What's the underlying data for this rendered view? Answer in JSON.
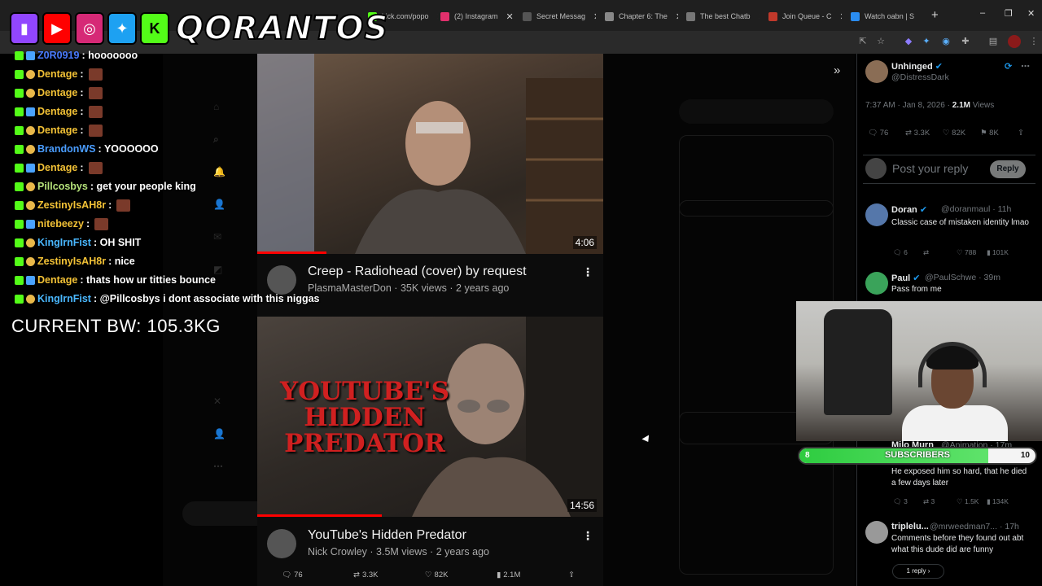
{
  "browser": {
    "tabs": [
      {
        "label": "kick.com/popo",
        "color": "#53fc18"
      },
      {
        "label": "(2) Instagram",
        "color": "#e1306c"
      },
      {
        "label": "Secret Messag",
        "color": "#3a3a3a"
      },
      {
        "label": "Chapter 6: The",
        "color": "#888888"
      },
      {
        "label": "The best Chatb",
        "color": "#777777"
      },
      {
        "label": "Join Queue - C",
        "color": "#c0392b"
      },
      {
        "label": "Watch oabn | S",
        "color": "#2a8cf0"
      }
    ],
    "newtab": "+",
    "window_controls": [
      "–",
      "❐",
      "✕"
    ]
  },
  "overlay": {
    "brand": "QORANTOS",
    "socials": [
      {
        "icon": "twitch-icon",
        "color": "#9146ff",
        "glyph": "▮"
      },
      {
        "icon": "youtube-icon",
        "color": "#ff0000",
        "glyph": "▶"
      },
      {
        "icon": "instagram-icon",
        "color": "#d62976",
        "glyph": "◎"
      },
      {
        "icon": "twitter-icon",
        "color": "#1da1f2",
        "glyph": "🐦"
      },
      {
        "icon": "kick-icon",
        "color": "#53fc18",
        "glyph": "K"
      }
    ],
    "bw_text": "CURRENT BW: 105.3KG"
  },
  "chat": [
    {
      "user": "Z0R0919",
      "color": "#4a7cff",
      "msg": ": hooooooo",
      "emote": false
    },
    {
      "user": "Dentage",
      "color": "#f3c236",
      "msg": ":",
      "emote": true
    },
    {
      "user": "Dentage",
      "color": "#f3c236",
      "msg": ":",
      "emote": true
    },
    {
      "user": "Dentage",
      "color": "#f3c236",
      "msg": ":",
      "emote": true
    },
    {
      "user": "Dentage",
      "color": "#f3c236",
      "msg": ":",
      "emote": true
    },
    {
      "user": "BrandonWS",
      "color": "#4a9dff",
      "msg": ": YOOOOOO",
      "emote": false
    },
    {
      "user": "Dentage",
      "color": "#f3c236",
      "msg": ":",
      "emote": true
    },
    {
      "user": "Pillcosbys",
      "color": "#b5e27a",
      "msg": ": get your people king",
      "emote": false
    },
    {
      "user": "ZestinyIsAH8r",
      "color": "#f3c236",
      "msg": ":",
      "emote": true
    },
    {
      "user": "nitebeezy",
      "color": "#f3c236",
      "msg": ":",
      "emote": true
    },
    {
      "user": "KingIrnFist",
      "color": "#4ab8ff",
      "msg": ": OH SHIT",
      "emote": false
    },
    {
      "user": "ZestinyIsAH8r",
      "color": "#f3c236",
      "msg": ": nice",
      "emote": false
    },
    {
      "user": "Dentage",
      "color": "#f3c236",
      "msg": ": thats how ur titties bounce",
      "emote": false
    },
    {
      "user": "KingIrnFist",
      "color": "#4ab8ff",
      "msg": ": @Pillcosbys i dont associate with this niggas",
      "emote": false
    }
  ],
  "videos": [
    {
      "title": "Creep -  Radiohead (cover) by request",
      "channel": "PlasmaMasterDon",
      "views": "35K views",
      "age": "2 years ago",
      "duration": "4:06",
      "progress": 0.2,
      "thumb_text": ""
    },
    {
      "title": "YouTube's Hidden Predator",
      "channel": "Nick Crowley",
      "views": "3.5M views",
      "age": "2 years ago",
      "duration": "14:56",
      "progress": 0.36,
      "thumb_text": "YOUTUBE'S HIDDEN PREDATOR"
    }
  ],
  "video_actions": {
    "replies": "76",
    "reposts": "3.3K",
    "likes": "82K",
    "views": "2.1M"
  },
  "tweet": {
    "name": "Unhinged",
    "handle": "@DistressDark",
    "time": "7:37 AM · Jan 8, 2026 ·",
    "views_count": "2.1M",
    "views_label": "Views",
    "stats": {
      "replies": "76",
      "reposts": "3.3K",
      "likes": "82K",
      "bookmarks": "8K"
    },
    "reply_placeholder": "Post your reply",
    "reply_button": "Reply"
  },
  "replies": [
    {
      "name": "Doran",
      "handle": "@doranmaul · 11h",
      "text": "Classic case of mistaken identity lmao",
      "stats": [
        "6",
        "",
        "788",
        "101K"
      ],
      "avatar_color": "#5577aa"
    },
    {
      "name": "Paul",
      "handle": "@PaulSchwe · 39m",
      "text": "Pass from me",
      "stats": [],
      "avatar_color": "#3aa35a"
    },
    {
      "name": "Milo Murn",
      "handle": "@Animation · 17m",
      "text": "He exposed him so hard, that he died a few days later",
      "stats": [
        "3",
        "3",
        "1.5K",
        "134K"
      ],
      "avatar_color": "#777777"
    },
    {
      "name": "triplelu...",
      "handle": "@mrweedman7... · 17h",
      "text": "Comments before they found out abt what this dude did are funny",
      "stats": [],
      "avatar_color": "#999999"
    }
  ],
  "replies_more": "1 reply",
  "subgoal": {
    "label": "SUBSCRIBERS",
    "current": "8",
    "target": "10",
    "progress": 0.8
  }
}
